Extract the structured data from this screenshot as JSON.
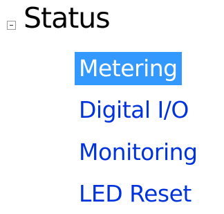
{
  "tree": {
    "root": {
      "label": "Status",
      "expander_icon": "minus-box-icon",
      "expanded": true
    },
    "children": [
      {
        "label": "Metering",
        "selected": true
      },
      {
        "label": "Digital I/O",
        "selected": false
      },
      {
        "label": "Monitoring",
        "selected": false
      },
      {
        "label": "LED Reset",
        "selected": false
      }
    ]
  },
  "colors": {
    "selected_bg": "#3399ff",
    "selected_text": "#ffffff",
    "link_text": "#0033dd",
    "root_text": "#000000"
  }
}
